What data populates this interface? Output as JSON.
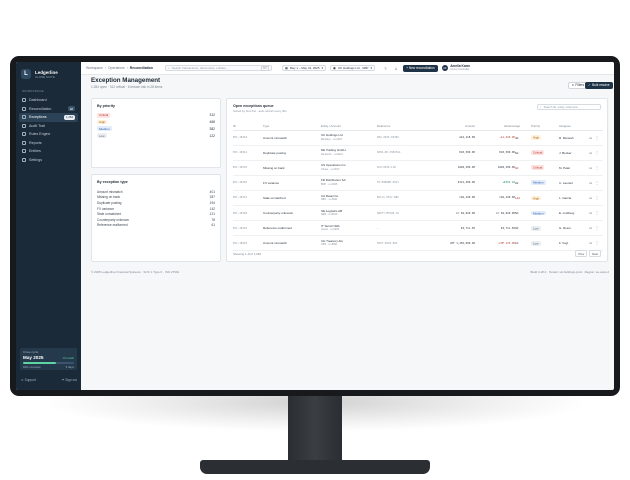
{
  "sidebar": {
    "brand": "Ledgerline",
    "brand_sub": "CLOSE SUITE",
    "section_label": "WORKSPACE",
    "items": [
      {
        "label": "Dashboard",
        "badge": ""
      },
      {
        "label": "Reconciliation",
        "badge": "48"
      },
      {
        "label": "Exceptions",
        "badge": "1,284"
      },
      {
        "label": "Audit Trail",
        "badge": ""
      },
      {
        "label": "Rules Engine",
        "badge": ""
      },
      {
        "label": "Reports",
        "badge": ""
      },
      {
        "label": "Entities",
        "badge": ""
      },
      {
        "label": "Settings",
        "badge": ""
      }
    ],
    "close": {
      "label": "Close cycle",
      "month": "May 2025",
      "status": "On track",
      "progress": 0.64,
      "left_text": "64% complete",
      "right_text": "5 days"
    },
    "footer_left": "Support",
    "footer_right": "Sign out"
  },
  "topbar": {
    "crumbs": [
      "Workspace",
      "Operations",
      "Reconciliation"
    ],
    "search_placeholder": "Search transactions, documents, entities...",
    "search_kbd": "⌘K",
    "date_range": "May 1 – May 31, 2025",
    "entity": "UK Holdings Ltd · GBP",
    "new_button": "New reconciliation",
    "user_initials": "AK",
    "user_name": "Amelia Kwon",
    "user_role": "Group Controller"
  },
  "header": {
    "title": "Exception Management",
    "subtitle": "1,284 open · 312 critical · 6 breach risk in 28 items",
    "filters": "Filters",
    "bulk": "Bulk resolve"
  },
  "priority": {
    "title": "By priority",
    "rows": [
      {
        "label": "Critical",
        "value": "312",
        "tone": "crit"
      },
      {
        "label": "High",
        "value": "468",
        "tone": "high"
      },
      {
        "label": "Medium",
        "value": "382",
        "tone": "med"
      },
      {
        "label": "Low",
        "value": "122",
        "tone": "low"
      }
    ]
  },
  "types": {
    "title": "By exception type",
    "rows": [
      {
        "label": "Amount mismatch",
        "value": "401"
      },
      {
        "label": "Missing on bank",
        "value": "287"
      },
      {
        "label": "Duplicate posting",
        "value": "194"
      },
      {
        "label": "FX variance",
        "value": "142"
      },
      {
        "label": "Stale unmatched",
        "value": "121"
      },
      {
        "label": "Counterparty unknown",
        "value": "78"
      },
      {
        "label": "Reference malformed",
        "value": "61"
      }
    ]
  },
  "queue": {
    "title": "Open exceptions queue",
    "subtitle": "Sorted by SLA first · auto-refresh every 30s",
    "search_placeholder": "Search ID, entity, reference...",
    "columns": [
      "ID",
      "Type",
      "Entity / Account",
      "Reference",
      "Amount",
      "Variance",
      "Age",
      "Priority",
      "Assignee"
    ],
    "rows": [
      {
        "id": "EXC-18344",
        "type": "Amount mismatch",
        "entity": "UK Holdings Ltd",
        "account": "Barclays · ••••4418",
        "ref": "INV-2025-04382",
        "amount": "£42,118.00",
        "variance": "−£1,420.00",
        "var_tone": "neg",
        "age": "4d",
        "priority": "High",
        "tone": "high",
        "assignee": "R. Mensah"
      },
      {
        "id": "EXC-18341",
        "type": "Duplicate posting",
        "entity": "DE Trading GmbH",
        "account": "Deutsche · ••••9021",
        "ref": "SEPA-DE-3382014",
        "amount": "€18,500.00",
        "variance": "€18,500.00",
        "var_tone": "",
        "age": "6d",
        "priority": "Critical",
        "tone": "crit",
        "assignee": "J. Becker"
      },
      {
        "id": "EXC-18339",
        "type": "Missing on bank",
        "entity": "US Operations Inc.",
        "account": "Chase · ••••0072",
        "ref": "ACH-0529-118",
        "amount": "$248,300.00",
        "variance": "$248,300.00",
        "var_tone": "",
        "age": "9d",
        "priority": "Critical",
        "tone": "crit",
        "assignee": "M. Patel"
      },
      {
        "id": "EXC-18336",
        "type": "FX variance",
        "entity": "FR Distribution SA",
        "account": "BNP · ••••3345",
        "ref": "FX-EURGBP-0521",
        "amount": "€112,400.00",
        "variance": "+€362.18",
        "var_tone": "pos",
        "age": "2d",
        "priority": "Medium",
        "tone": "med",
        "assignee": "C. Laurent"
      },
      {
        "id": "EXC-18331",
        "type": "Stale unmatched",
        "entity": "CA Retail Co.",
        "account": "RBC · ••••5521",
        "ref": "Batch-0517-RBC",
        "amount": "C$9,240.00",
        "variance": "C$9,240.00",
        "var_tone": "",
        "age": "14d",
        "priority": "High",
        "tone": "high",
        "assignee": "L. Garcia"
      },
      {
        "id": "EXC-18328",
        "type": "Counterparty unknown",
        "entity": "SE Logistics AB",
        "account": "SEB · ••••6610",
        "ref": "SWIFT-MT940-19",
        "amount": "kr 84,920.00",
        "variance": "kr 84,920.00",
        "var_tone": "",
        "age": "5d",
        "priority": "Medium",
        "tone": "med",
        "assignee": "E. Lindberg"
      },
      {
        "id": "EXC-18322",
        "type": "Reference malformed",
        "entity": "IT Servizi SRL",
        "account": "Intesa · ••••1204",
        "ref": "—",
        "amount": "€4,711.50",
        "variance": "€4,711.50",
        "var_tone": "",
        "age": "3d",
        "priority": "Low",
        "tone": "low",
        "assignee": "G. Rossi"
      },
      {
        "id": "EXC-18318",
        "type": "Amount mismatch",
        "entity": "CH Treasury AG",
        "account": "UBS · ••••8891",
        "ref": "TRSY-0520-004",
        "amount": "CHF 1,250,000.00",
        "variance": "−CHF 125.00",
        "var_tone": "neg",
        "age": "1d",
        "priority": "Low",
        "tone": "low",
        "assignee": "F. Vogt"
      }
    ],
    "footer": "Showing 1–8 of 1,284",
    "prev": "Prev",
    "next": "Next"
  },
  "footer": {
    "left": "© 2025 Ledgerline Financial Systems · SOC 1 Type II · ISO 27001",
    "right": "Build 4.18.2 · Tenant: uk-holdings-prod · Region: eu-west-2"
  }
}
